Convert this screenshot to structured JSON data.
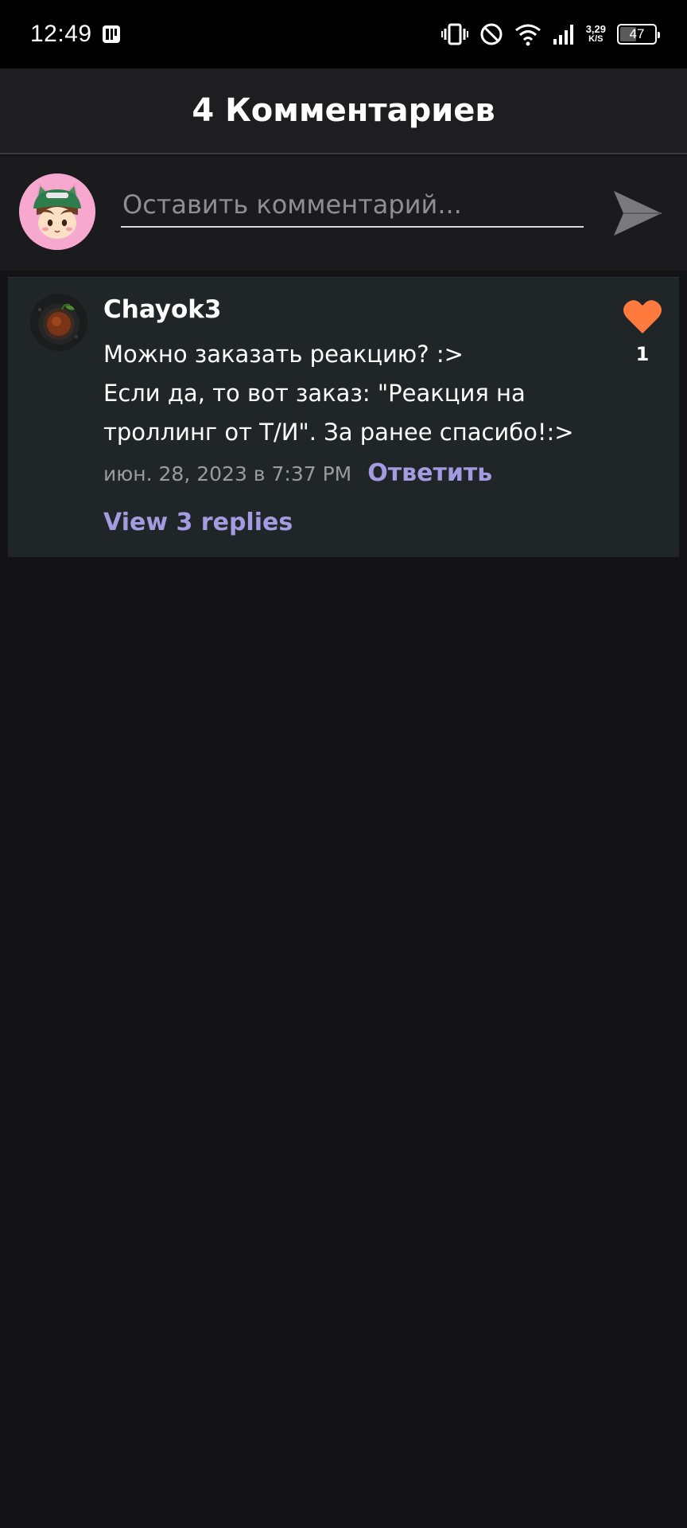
{
  "status_bar": {
    "time": "12:49",
    "net_speed_value": "3,29",
    "net_speed_unit": "K/S",
    "battery": "47",
    "battery_level": 0.47
  },
  "header": {
    "title": "4 Комментариев"
  },
  "composer": {
    "placeholder": "Оставить комментарий..."
  },
  "comments": [
    {
      "author": "Chayok3",
      "text_lines": [
        "Можно заказать реакцию? :>",
        "Если да, то вот заказ: \"Реакция на",
        "троллинг от Т/И\". За ранее спасибо!:>"
      ],
      "date": "июн. 28, 2023 в 7:37 PM",
      "reply_label": "Ответить",
      "view_replies_label": "View 3 replies",
      "likes": "1"
    }
  ],
  "colors": {
    "accent": "#a49be0",
    "like": "#ff7a3c",
    "background": "#131214",
    "card": "#202628"
  }
}
